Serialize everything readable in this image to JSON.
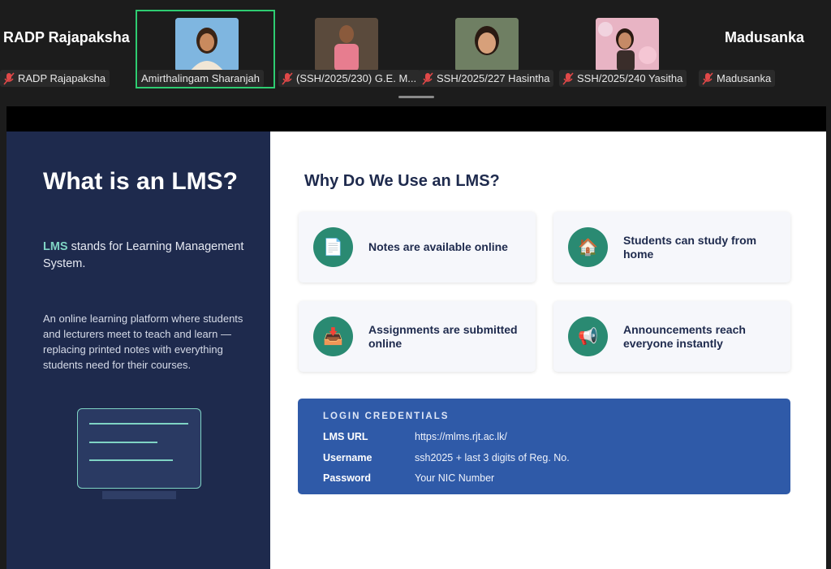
{
  "participants": [
    {
      "display_name": "RADP Rajapaksha",
      "label": "RADP Rajapaksha",
      "muted": true
    },
    {
      "display_name": "",
      "label": "Amirthalingam Sharanjah",
      "muted": false,
      "active": true
    },
    {
      "display_name": "",
      "label": "(SSH/2025/230) G.E. M...",
      "muted": true
    },
    {
      "display_name": "",
      "label": "SSH/2025/227 Hasintha",
      "muted": true
    },
    {
      "display_name": "",
      "label": "SSH/2025/240 Yasitha",
      "muted": true
    },
    {
      "display_name": "Madusanka",
      "label": "Madusanka",
      "muted": true
    }
  ],
  "slide": {
    "left": {
      "title": "What is an LMS?",
      "highlight": "LMS",
      "subtitle_rest": " stands for Learning Management System.",
      "description": "An online learning platform where students and lecturers meet to teach and learn — replacing printed notes with everything students need for their courses."
    },
    "right": {
      "title": "Why Do We Use an LMS?",
      "cards": [
        {
          "text": "Notes are available online",
          "icon": "document-icon",
          "glyph": "📄"
        },
        {
          "text": "Students can study from home",
          "icon": "house-icon",
          "glyph": "🏠"
        },
        {
          "text": "Assignments are submitted online",
          "icon": "upload-icon",
          "glyph": "📥"
        },
        {
          "text": "Announcements reach everyone instantly",
          "icon": "megaphone-icon",
          "glyph": "📢"
        }
      ],
      "credentials": {
        "heading": "LOGIN CREDENTIALS",
        "rows": [
          {
            "key": "LMS URL",
            "value": "https://mlms.rjt.ac.lk/"
          },
          {
            "key": "Username",
            "value": "ssh2025 + last 3 digits of Reg. No."
          },
          {
            "key": "Password",
            "value": "Your NIC Number"
          }
        ]
      }
    }
  },
  "colors": {
    "slide_dark": "#1e2a4d",
    "teal": "#2a8a72",
    "cred_blue": "#2f5aa8",
    "active_border": "#2ecc71"
  }
}
